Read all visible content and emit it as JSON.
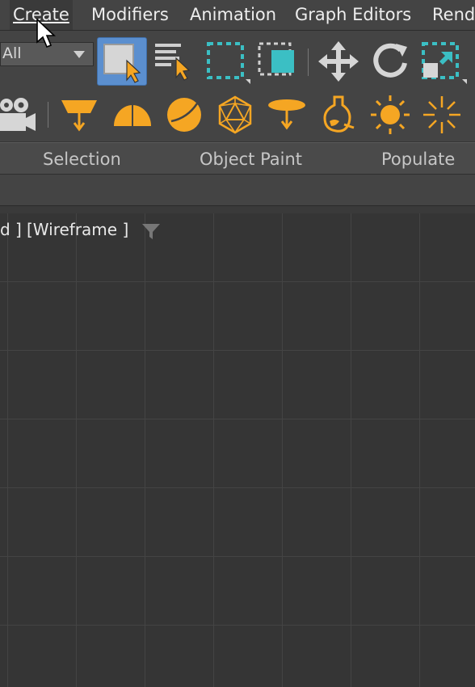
{
  "menubar": {
    "items": [
      "Create",
      "Modifiers",
      "Animation",
      "Graph Editors",
      "Rend"
    ],
    "underlines": [
      "C",
      "M",
      "A",
      "d",
      ""
    ]
  },
  "main_toolbar": {
    "selection_filter_value": "All",
    "icons": [
      "select-object-icon",
      "select-by-name-icon",
      "rectangular-selection-region-icon",
      "window-crossing-icon",
      "select-and-move-icon",
      "select-and-rotate-icon",
      "select-and-scale-icon"
    ]
  },
  "create_toolbar": {
    "icons": [
      "camera-icon",
      "target-spotlight-icon",
      "skydome-icon",
      "sphere-light-icon",
      "geosphere-icon",
      "free-spot-icon",
      "photometric-light-icon",
      "sun-icon",
      "skylight-icon"
    ]
  },
  "ribbon": {
    "tabs": [
      "Selection",
      "Object Paint",
      "Populate"
    ]
  },
  "viewport": {
    "label_part1": "d ]",
    "label_part2": "[Wireframe ]"
  },
  "colors": {
    "accent_orange": "#f5a623",
    "accent_teal": "#3bbfc4",
    "active_blue": "#5b8fcf"
  }
}
